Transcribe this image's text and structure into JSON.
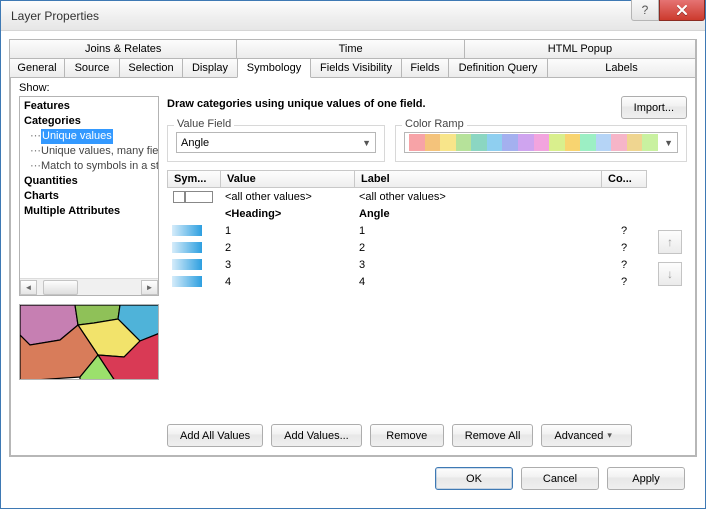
{
  "window": {
    "title": "Layer Properties"
  },
  "title_buttons": {
    "help": "?",
    "close": "×"
  },
  "tabs_row1": [
    {
      "label": "Joins & Relates"
    },
    {
      "label": "Time"
    },
    {
      "label": "HTML Popup"
    }
  ],
  "tabs_row2": [
    {
      "label": "General"
    },
    {
      "label": "Source"
    },
    {
      "label": "Selection"
    },
    {
      "label": "Display"
    },
    {
      "label": "Symbology"
    },
    {
      "label": "Fields Visibility"
    },
    {
      "label": "Fields"
    },
    {
      "label": "Definition Query"
    },
    {
      "label": "Labels"
    }
  ],
  "active_tab": "Symbology",
  "show_label": "Show:",
  "tree": {
    "features": "Features",
    "categories": "Categories",
    "cat_children": [
      "Unique values",
      "Unique values, many fields",
      "Match to symbols in a style"
    ],
    "quantities": "Quantities",
    "charts": "Charts",
    "multiple": "Multiple Attributes"
  },
  "desc": "Draw categories using unique values of one field.",
  "import_btn": "Import...",
  "value_field": {
    "legend": "Value Field",
    "value": "Angle"
  },
  "color_ramp": {
    "legend": "Color Ramp",
    "colors": [
      "#f7a3a7",
      "#f4c37b",
      "#f8e58a",
      "#b6e29a",
      "#8bd6c2",
      "#8fcff0",
      "#a4b0ef",
      "#cfa4ef",
      "#f2a4de",
      "#d9ef8d",
      "#f8d470",
      "#9cefc4",
      "#b5d4f6",
      "#f6b5c8",
      "#efd590",
      "#c9f1a0"
    ]
  },
  "grid": {
    "headers": {
      "sym": "Sym...",
      "value": "Value",
      "label": "Label",
      "count": "Co..."
    },
    "rows": [
      {
        "kind": "allother",
        "value": "<all other values>",
        "label": "<all other values>",
        "count": ""
      },
      {
        "kind": "heading",
        "value": "<Heading>",
        "label": "Angle",
        "count": ""
      },
      {
        "kind": "data",
        "value": "1",
        "label": "1",
        "count": "?"
      },
      {
        "kind": "data",
        "value": "2",
        "label": "2",
        "count": "?"
      },
      {
        "kind": "data",
        "value": "3",
        "label": "3",
        "count": "?"
      },
      {
        "kind": "data",
        "value": "4",
        "label": "4",
        "count": "?"
      }
    ]
  },
  "action_buttons": {
    "add_all": "Add All Values",
    "add": "Add Values...",
    "remove": "Remove",
    "remove_all": "Remove All",
    "advanced": "Advanced"
  },
  "footer": {
    "ok": "OK",
    "cancel": "Cancel",
    "apply": "Apply"
  }
}
